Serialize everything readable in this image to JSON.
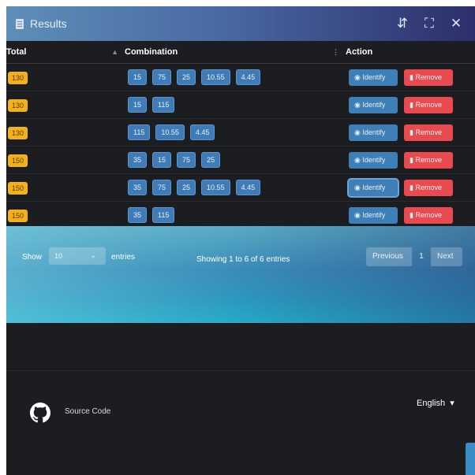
{
  "window": {
    "title": "Results",
    "icons": [
      "collapse-icon",
      "expand-icon",
      "close-icon"
    ]
  },
  "table": {
    "headers": {
      "total": "Total",
      "combination": "Combination",
      "action": "Action"
    },
    "rows": [
      {
        "total": "130",
        "combination": [
          "15",
          "75",
          "25",
          "10.55",
          "4.45"
        ]
      },
      {
        "total": "130",
        "combination": [
          "15",
          "115"
        ]
      },
      {
        "total": "130",
        "combination": [
          "115",
          "10.55",
          "4.45"
        ]
      },
      {
        "total": "150",
        "combination": [
          "35",
          "15",
          "75",
          "25"
        ]
      },
      {
        "total": "150",
        "combination": [
          "35",
          "75",
          "25",
          "10.55",
          "4.45"
        ]
      },
      {
        "total": "150",
        "combination": [
          "35",
          "115"
        ]
      }
    ],
    "actions": {
      "identify": "Identify",
      "remove": "Remove"
    }
  },
  "footer": {
    "show_label": "Show",
    "length_value": "10",
    "entries_label": "entries",
    "info": "Showing 1 to 6 of 6 entries",
    "pagination": {
      "previous": "Previous",
      "page": "1",
      "next": "Next"
    }
  },
  "page_footer": {
    "source_code": "Source Code",
    "language": "English"
  },
  "colors": {
    "total_badge": "#f2b01e",
    "chip": "#3e7bb7",
    "identify": "#3f7fb8",
    "remove": "#e84a4f"
  }
}
